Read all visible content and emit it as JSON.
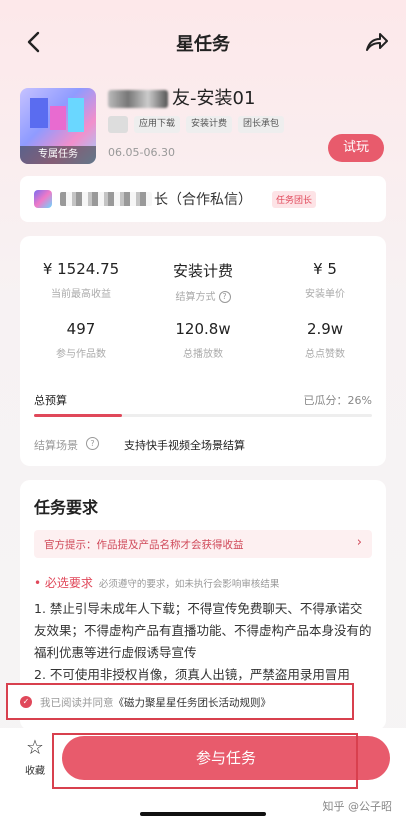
{
  "nav": {
    "title": "星任务"
  },
  "header": {
    "thumb_tag": "专属任务",
    "task_name": "友-安装01",
    "chips": [
      "应用下载",
      "安装计费",
      "团长承包"
    ],
    "dates": "06.05-06.30",
    "try_label": "试玩"
  },
  "team": {
    "name_suffix": "长（合作私信）",
    "badge": "任务团长"
  },
  "stats": {
    "max_income": {
      "value": "¥ 1524.75",
      "label": "当前最高收益"
    },
    "settle_method": {
      "value": "安装计费",
      "label": "结算方式"
    },
    "unit_price": {
      "value": "¥ 5",
      "label": "安装单价"
    },
    "works": {
      "value": "497",
      "label": "参与作品数"
    },
    "plays": {
      "value": "120.8w",
      "label": "总播放数"
    },
    "likes": {
      "value": "2.9w",
      "label": "总点赞数"
    },
    "budget_label": "总预算",
    "budget_split": "已瓜分：26%",
    "budget_progress": 0.26,
    "scene_label": "结算场景",
    "scene_value": "支持快手视频全场景结算"
  },
  "requirements": {
    "title": "任务要求",
    "tip": "官方提示：作品提及产品名称才会获得收益",
    "must_label": "• 必选要求",
    "must_desc": "必须遵守的要求，如未执行会影响审核结果",
    "rule1": "1. 禁止引导未成年人下载；不得宣传免费聊天、不得承诺交友效果；不得虚构产品有直播功能、不得虚构产品本身没有的福利优惠等进行虚假诱导宣传",
    "rule2": "2. 不可使用非授权肖像，须真人出镜，严禁盗用录用冒用"
  },
  "agree": {
    "prefix": "我已阅读并同意",
    "rule": "《磁力聚星星任务团长活动规则》"
  },
  "bottom": {
    "fav_label": "收藏",
    "join_label": "参与任务",
    "watermark": "知乎 @公子昭"
  },
  "icons": {
    "back": "back-arrow-icon",
    "share": "share-icon",
    "star": "star-outline-icon",
    "check": "check-circle-icon",
    "chevron": "chevron-right-icon",
    "help": "help-circle-icon"
  },
  "colors": {
    "accent": "#e85b6c",
    "annotation": "#d8404e"
  }
}
